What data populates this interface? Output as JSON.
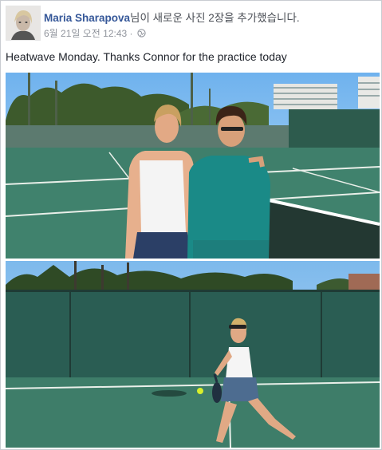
{
  "post": {
    "author": "Maria Sharapova",
    "action_suffix": "님이 새로운 사진 2장을 추가했습니다.",
    "timestamp": "6월 21일 오전 12:43 · ",
    "privacy_icon": "globe-icon",
    "text": "Heatwave Monday. Thanks Connor for the practice today"
  },
  "photos": [
    {
      "name": "photo-two-players-posing"
    },
    {
      "name": "photo-player-forehand"
    }
  ],
  "colors": {
    "author_link": "#365899",
    "meta_gray": "#90949c",
    "court_green": "#3f7f6b",
    "sky_blue": "#8ec1ee"
  }
}
